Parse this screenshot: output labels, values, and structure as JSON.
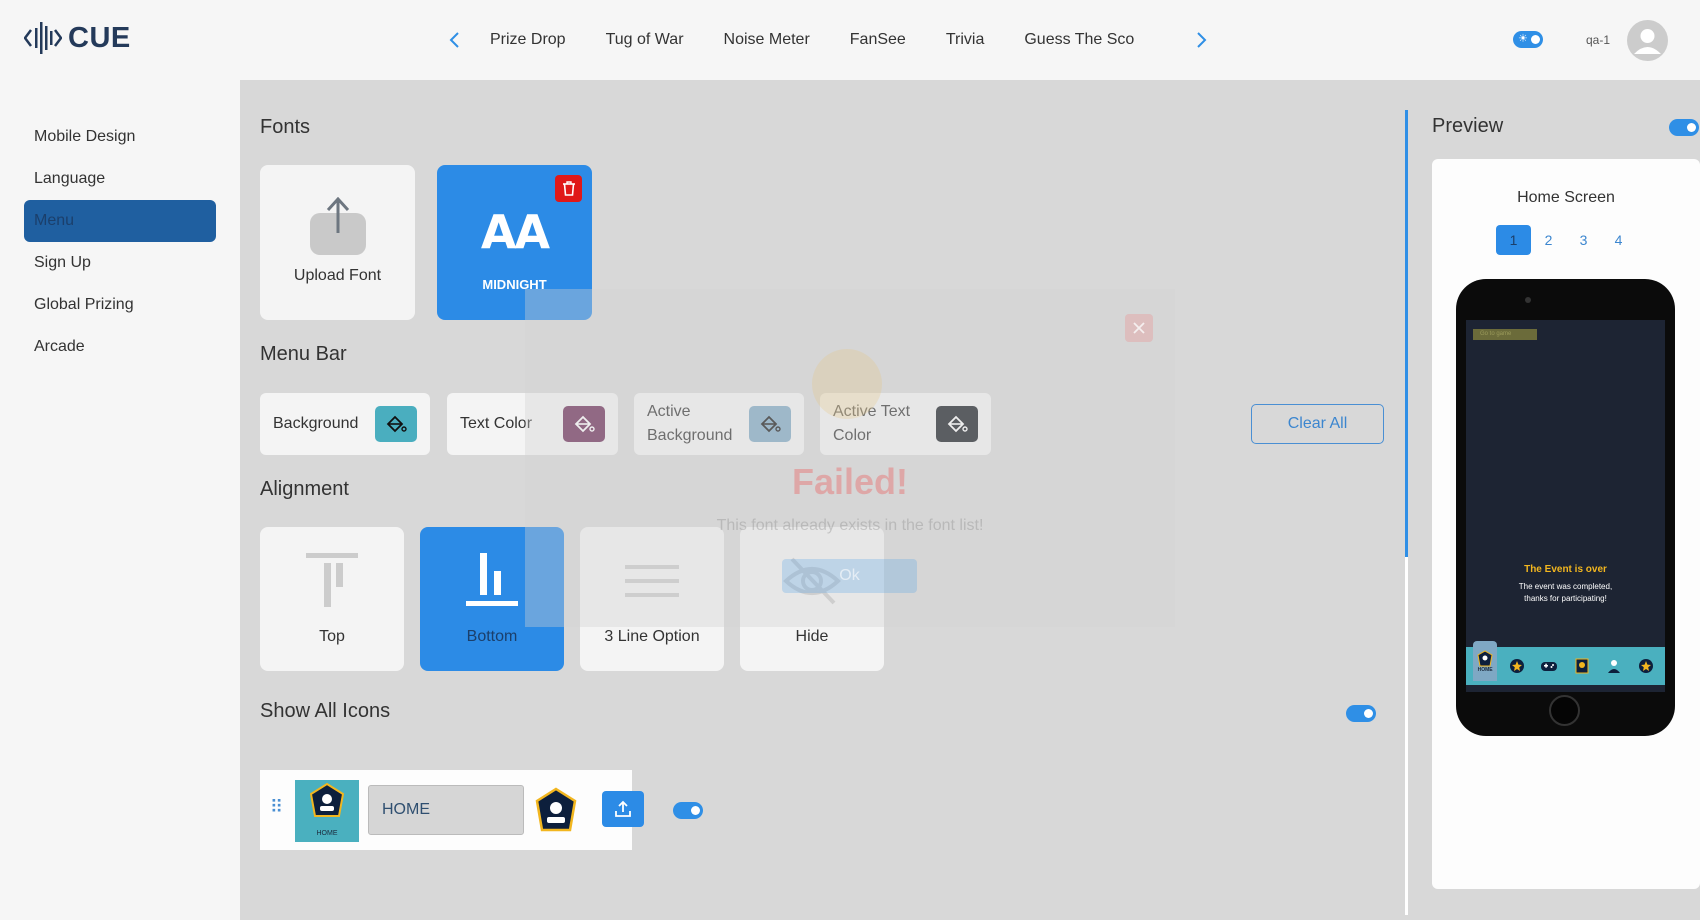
{
  "header": {
    "logo": "CUE",
    "nav_items": [
      "Prize Drop",
      "Tug of War",
      "Noise Meter",
      "FanSee",
      "Trivia",
      "Guess The Sco"
    ],
    "user_name": "qa-1"
  },
  "sidebar": {
    "items": [
      {
        "label": "Mobile Design"
      },
      {
        "label": "Language"
      },
      {
        "label": "Menu"
      },
      {
        "label": "Sign Up"
      },
      {
        "label": "Global Prizing"
      },
      {
        "label": "Arcade"
      }
    ],
    "active": "Menu"
  },
  "fonts": {
    "title": "Fonts",
    "upload_label": "Upload Font",
    "font_card_text": "AA",
    "font_card_name": "MIDNIGHT"
  },
  "menu_bar": {
    "title": "Menu Bar",
    "colors": [
      {
        "label_line1": "Background",
        "label_line2": "",
        "color": "#4aaebf"
      },
      {
        "label_line1": "Text Color",
        "label_line2": "",
        "color": "#6b2a55"
      },
      {
        "label_line1": "Active",
        "label_line2": "Background",
        "color": "#7fa8c4"
      },
      {
        "label_line1": "Active Text",
        "label_line2": "Color",
        "color": "#14181f"
      }
    ],
    "clear_all": "Clear All"
  },
  "alignment": {
    "title": "Alignment",
    "options": [
      {
        "label": "Top",
        "active": false
      },
      {
        "label": "Bottom",
        "active": true
      },
      {
        "label": "3 Line Option",
        "active": false
      },
      {
        "label": "Hide",
        "active": false
      }
    ]
  },
  "show_all_icons": {
    "title": "Show All Icons",
    "enabled": true,
    "rows": [
      {
        "caption": "HOME",
        "value": "HOME",
        "enabled": true
      }
    ]
  },
  "preview": {
    "title": "Preview",
    "enabled": true,
    "screen_name": "Home Screen",
    "pages": [
      "1",
      "2",
      "3",
      "4"
    ],
    "active_page": "1",
    "go_to_game": "Go to game",
    "event_title": "The Event is over",
    "event_text_1": "The event was completed,",
    "event_text_2": "thanks for participating!",
    "nav_caption": "HOME"
  },
  "modal": {
    "title": "Failed!",
    "message": "This font already exists in the font list!",
    "ok_label": "Ok"
  },
  "colors": {
    "accent": "#2c8be6",
    "sidebar_active": "#1f5fa0",
    "delete": "#e01818"
  }
}
